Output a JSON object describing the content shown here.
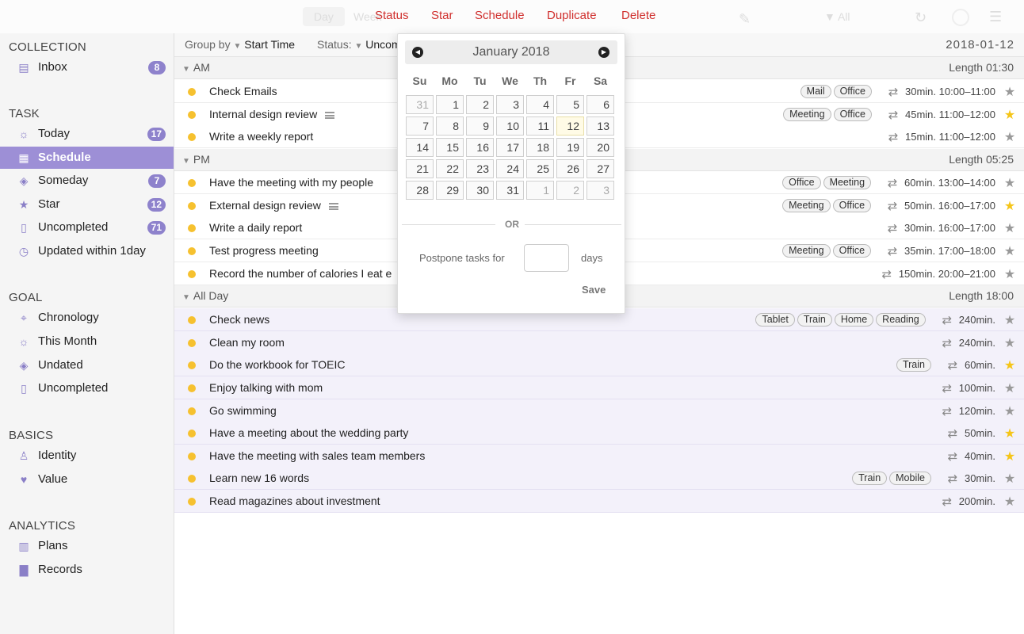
{
  "toolbar": {
    "ghost_day": "Day",
    "ghost_week": "Week",
    "ghost_all": "▼ All",
    "actions": [
      "Status",
      "Star",
      "Schedule",
      "Duplicate",
      "Delete"
    ]
  },
  "sidebar": {
    "collection_title": "COLLECTION",
    "collection": [
      {
        "label": "Inbox",
        "badge": "8",
        "icon": "inbox-icon"
      }
    ],
    "task_title": "TASK",
    "task": [
      {
        "label": "Today",
        "badge": "17",
        "icon": "sun-icon"
      },
      {
        "label": "Schedule",
        "badge": "",
        "icon": "calendar-icon"
      },
      {
        "label": "Someday",
        "badge": "7",
        "icon": "layers-icon"
      },
      {
        "label": "Star",
        "badge": "12",
        "icon": "star-icon"
      },
      {
        "label": "Uncompleted",
        "badge": "71",
        "icon": "document-icon"
      },
      {
        "label": "Updated within 1day",
        "badge": "",
        "icon": "stopwatch-icon"
      }
    ],
    "goal_title": "GOAL",
    "goal": [
      {
        "label": "Chronology",
        "icon": "telescope-icon"
      },
      {
        "label": "This Month",
        "icon": "sun-icon"
      },
      {
        "label": "Undated",
        "icon": "layers-icon"
      },
      {
        "label": "Uncompleted",
        "icon": "document-icon"
      }
    ],
    "basics_title": "BASICS",
    "basics": [
      {
        "label": "Identity",
        "icon": "person-icon"
      },
      {
        "label": "Value",
        "icon": "heart-icon"
      }
    ],
    "analytics_title": "ANALYTICS",
    "analytics": [
      {
        "label": "Plans",
        "icon": "bar-chart-outline-icon"
      },
      {
        "label": "Records",
        "icon": "bar-chart-icon"
      }
    ]
  },
  "header": {
    "group_by_label": "Group by",
    "group_by_value": "Start Time",
    "status_label": "Status:",
    "status_value": "Uncom",
    "date": "2018-01-12"
  },
  "groups": [
    {
      "name": "AM",
      "length": "Length 01:30"
    },
    {
      "name": "PM",
      "length": "Length 05:25"
    },
    {
      "name": "All Day",
      "length": "Length 18:00"
    }
  ],
  "tasks": [
    {
      "title": "Check Emails",
      "tags": [
        "Mail",
        "Office"
      ],
      "duration": "30min.",
      "time": "10:00–11:00",
      "starred": false,
      "note": false
    },
    {
      "title": "Internal design review",
      "tags": [
        "Meeting",
        "Office"
      ],
      "duration": "45min.",
      "time": "11:00–12:00",
      "starred": true,
      "note": true
    },
    {
      "title": "Write a weekly report",
      "tags": [],
      "duration": "15min.",
      "time": "11:00–12:00",
      "starred": false,
      "note": false
    },
    {
      "title": "Have the meeting with my people",
      "tags": [
        "Office",
        "Meeting"
      ],
      "duration": "60min.",
      "time": "13:00–14:00",
      "starred": false,
      "note": false
    },
    {
      "title": "External design review",
      "tags": [
        "Meeting",
        "Office"
      ],
      "duration": "50min.",
      "time": "16:00–17:00",
      "starred": true,
      "note": true
    },
    {
      "title": "Write a daily report",
      "tags": [],
      "duration": "30min.",
      "time": "16:00–17:00",
      "starred": false,
      "note": false
    },
    {
      "title": "Test progress meeting",
      "tags": [
        "Meeting",
        "Office"
      ],
      "duration": "35min.",
      "time": "17:00–18:00",
      "starred": false,
      "note": false
    },
    {
      "title": "Record the number of calories I eat e",
      "tags": [],
      "duration": "150min.",
      "time": "20:00–21:00",
      "starred": false,
      "note": false
    },
    {
      "title": "Check news",
      "tags": [
        "Tablet",
        "Train",
        "Home",
        "Reading"
      ],
      "duration": "240min.",
      "time": "",
      "starred": false,
      "note": false
    },
    {
      "title": "Clean my room",
      "tags": [],
      "duration": "240min.",
      "time": "",
      "starred": false,
      "note": false
    },
    {
      "title": "Do the workbook for TOEIC",
      "tags": [
        "Train"
      ],
      "duration": "60min.",
      "time": "",
      "starred": true,
      "note": false
    },
    {
      "title": "Enjoy talking with mom",
      "tags": [],
      "duration": "100min.",
      "time": "",
      "starred": false,
      "note": false
    },
    {
      "title": "Go swimming",
      "tags": [],
      "duration": "120min.",
      "time": "",
      "starred": false,
      "note": false
    },
    {
      "title": "Have a meeting about the wedding party",
      "tags": [],
      "duration": "50min.",
      "time": "",
      "starred": true,
      "note": false
    },
    {
      "title": "Have the meeting with sales team members",
      "tags": [],
      "duration": "40min.",
      "time": "",
      "starred": true,
      "note": false
    },
    {
      "title": "Learn new 16 words",
      "tags": [
        "Train",
        "Mobile"
      ],
      "duration": "30min.",
      "time": "",
      "starred": false,
      "note": false
    },
    {
      "title": "Read magazines about investment",
      "tags": [],
      "duration": "200min.",
      "time": "",
      "starred": false,
      "note": false
    }
  ],
  "calendar": {
    "month": "January 2018",
    "weekdays": [
      "Su",
      "Mo",
      "Tu",
      "We",
      "Th",
      "Fr",
      "Sa"
    ],
    "weeks": [
      [
        "31",
        "1",
        "2",
        "3",
        "4",
        "5",
        "6"
      ],
      [
        "7",
        "8",
        "9",
        "10",
        "11",
        "12",
        "13"
      ],
      [
        "14",
        "15",
        "16",
        "17",
        "18",
        "19",
        "20"
      ],
      [
        "21",
        "22",
        "23",
        "24",
        "25",
        "26",
        "27"
      ],
      [
        "28",
        "29",
        "30",
        "31",
        "1",
        "2",
        "3"
      ]
    ],
    "today": "12",
    "or_label": "OR",
    "postpone_label": "Postpone tasks for",
    "postpone_value": "",
    "days_label": "days",
    "save_label": "Save"
  },
  "colors": {
    "accent": "#9d8fd6",
    "action_red": "#d0302e",
    "dot_yellow": "#f6c12f",
    "star_on": "#f5c518"
  }
}
